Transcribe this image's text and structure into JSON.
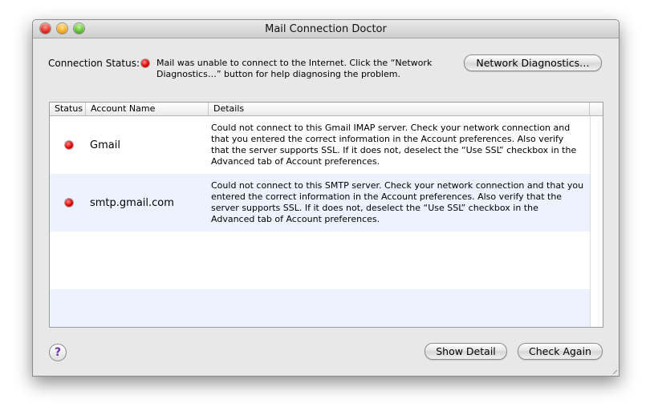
{
  "window": {
    "title": "Mail Connection Doctor"
  },
  "connection": {
    "label": "Connection Status:",
    "message": "Mail was unable to connect to the Internet. Click the “Network Diagnostics…” button for help diagnosing the problem.",
    "indicator_color": "#e00000"
  },
  "buttons": {
    "network_diagnostics": "Network Diagnostics…",
    "show_detail": "Show Detail",
    "check_again": "Check Again",
    "help": "?"
  },
  "table": {
    "columns": [
      "Status",
      "Account Name",
      "Details"
    ],
    "rows": [
      {
        "status": "red",
        "name": "Gmail",
        "details": "Could not connect to this Gmail IMAP server. Check your network connection and that you entered the correct information in the Account preferences. Also verify that the server supports SSL. If it does not, deselect the “Use SSL” checkbox in the Advanced tab of Account preferences."
      },
      {
        "status": "red",
        "name": "smtp.gmail.com",
        "details": "Could not connect to this SMTP server. Check your network connection and that you entered the correct information in the Account preferences. Also verify that the server supports SSL. If it does not, deselect the “Use SSL” checkbox in the Advanced tab of Account preferences."
      }
    ]
  },
  "colors": {
    "alt_row": "#edf3fe",
    "status_red": "#e00000"
  }
}
